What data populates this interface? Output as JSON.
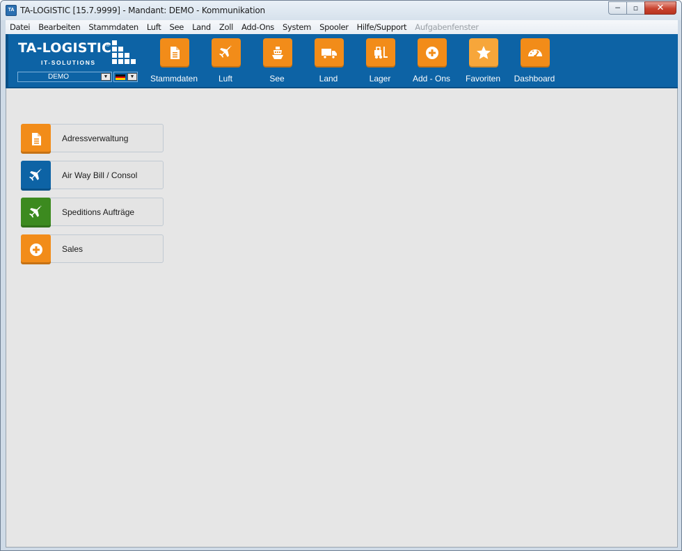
{
  "window": {
    "title": "TA-LOGISTIC [15.7.9999] - Mandant: DEMO - Kommunikation",
    "app_icon_text": "TA",
    "controls": {
      "minimize": "─",
      "maximize": "▫",
      "close": "✕"
    }
  },
  "menubar": {
    "items": [
      {
        "label": "Datei",
        "enabled": true
      },
      {
        "label": "Bearbeiten",
        "enabled": true
      },
      {
        "label": "Stammdaten",
        "enabled": true
      },
      {
        "label": "Luft",
        "enabled": true
      },
      {
        "label": "See",
        "enabled": true
      },
      {
        "label": "Land",
        "enabled": true
      },
      {
        "label": "Zoll",
        "enabled": true
      },
      {
        "label": "Add-Ons",
        "enabled": true
      },
      {
        "label": "System",
        "enabled": true
      },
      {
        "label": "Spooler",
        "enabled": true
      },
      {
        "label": "Hilfe/Support",
        "enabled": true
      },
      {
        "label": "Aufgabenfenster",
        "enabled": false
      }
    ]
  },
  "logo": {
    "name": "TA-LOGISTIC",
    "registered": "®",
    "subtitle": "IT-SOLUTIONS"
  },
  "mandant": {
    "selected": "DEMO",
    "language_flag": "de"
  },
  "nav": {
    "items": [
      {
        "label": "Stammdaten",
        "icon": "document-icon",
        "active": false
      },
      {
        "label": "Luft",
        "icon": "airplane-icon",
        "active": false
      },
      {
        "label": "See",
        "icon": "ship-icon",
        "active": false
      },
      {
        "label": "Land",
        "icon": "truck-icon",
        "active": false
      },
      {
        "label": "Lager",
        "icon": "forklift-icon",
        "active": false
      },
      {
        "label": "Add - Ons",
        "icon": "plus-circle-icon",
        "active": false
      },
      {
        "label": "Favoriten",
        "icon": "star-icon",
        "active": true
      },
      {
        "label": "Dashboard",
        "icon": "gauge-icon",
        "active": false
      }
    ]
  },
  "favorites": {
    "items": [
      {
        "label": "Adressverwaltung",
        "icon": "document-icon",
        "color": "#f28c19"
      },
      {
        "label": "Air Way Bill / Consol",
        "icon": "airplane-icon",
        "color": "#0d63a5"
      },
      {
        "label": "Speditions Aufträge",
        "icon": "airplane-icon",
        "color": "#3c8a1f"
      },
      {
        "label": "Sales",
        "icon": "plus-circle-icon",
        "color": "#f28c19"
      }
    ]
  },
  "colors": {
    "ribbon": "#0d63a5",
    "accent_orange": "#f28c19",
    "content_bg": "#e6e6e6"
  }
}
